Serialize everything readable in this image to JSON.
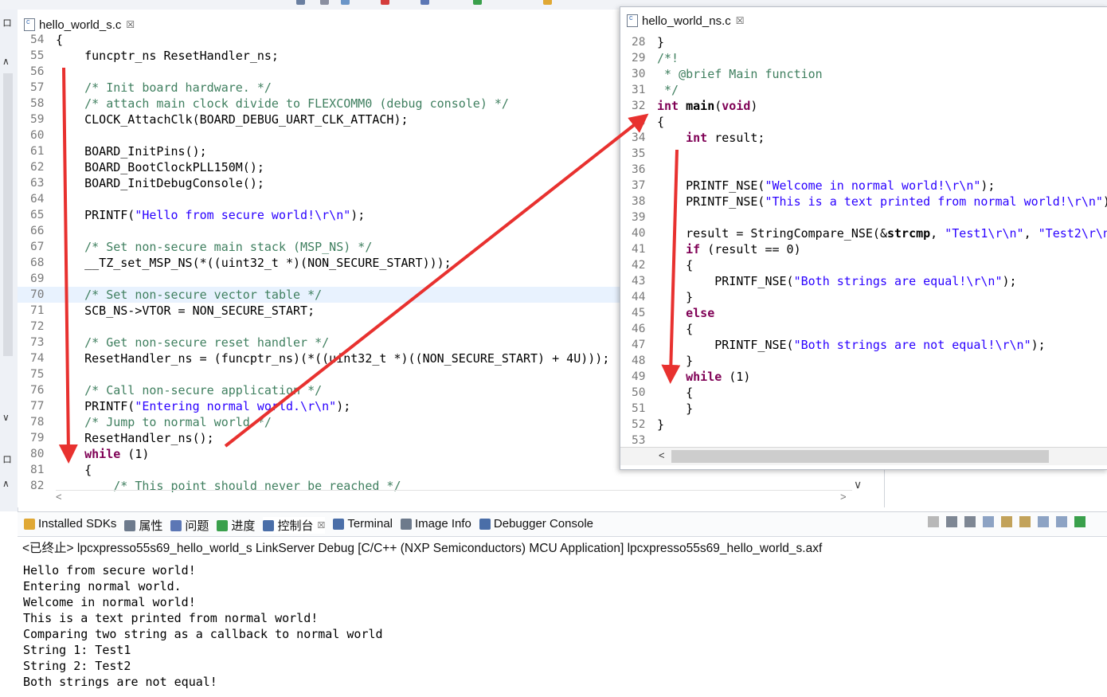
{
  "colors": {
    "arrow": "#e8312f",
    "keyword": "#7f0055",
    "comment": "#3f7f5f",
    "string": "#2a00ff",
    "highlight": "#e8f2fe"
  },
  "main_editor": {
    "tab_title": "hello_world_s.c",
    "lines": [
      {
        "n": "54",
        "text": "{"
      },
      {
        "n": "55",
        "text": "    funcptr_ns ResetHandler_ns;"
      },
      {
        "n": "56",
        "text": ""
      },
      {
        "n": "57",
        "text": "    /* Init board hardware. */"
      },
      {
        "n": "58",
        "text": "    /* attach main clock divide to FLEXCOMM0 (debug console) */"
      },
      {
        "n": "59",
        "text": "    CLOCK_AttachClk(BOARD_DEBUG_UART_CLK_ATTACH);"
      },
      {
        "n": "60",
        "text": ""
      },
      {
        "n": "61",
        "text": "    BOARD_InitPins();"
      },
      {
        "n": "62",
        "text": "    BOARD_BootClockPLL150M();"
      },
      {
        "n": "63",
        "text": "    BOARD_InitDebugConsole();"
      },
      {
        "n": "64",
        "text": ""
      },
      {
        "n": "65",
        "text": "    PRINTF(\"Hello from secure world!\\r\\n\");"
      },
      {
        "n": "66",
        "text": ""
      },
      {
        "n": "67",
        "text": "    /* Set non-secure main stack (MSP_NS) */"
      },
      {
        "n": "68",
        "text": "    __TZ_set_MSP_NS(*((uint32_t *)(NON_SECURE_START)));"
      },
      {
        "n": "69",
        "text": ""
      },
      {
        "n": "70",
        "text": "    /* Set non-secure vector table */"
      },
      {
        "n": "71",
        "text": "    SCB_NS->VTOR = NON_SECURE_START;"
      },
      {
        "n": "72",
        "text": ""
      },
      {
        "n": "73",
        "text": "    /* Get non-secure reset handler */"
      },
      {
        "n": "74",
        "text": "    ResetHandler_ns = (funcptr_ns)(*((uint32_t *)((NON_SECURE_START) + 4U)));"
      },
      {
        "n": "75",
        "text": ""
      },
      {
        "n": "76",
        "text": "    /* Call non-secure application */"
      },
      {
        "n": "77",
        "text": "    PRINTF(\"Entering normal world.\\r\\n\");"
      },
      {
        "n": "78",
        "text": "    /* Jump to normal world */"
      },
      {
        "n": "79",
        "text": "    ResetHandler_ns();"
      },
      {
        "n": "80",
        "text": "    while (1)"
      },
      {
        "n": "81",
        "text": "    {"
      },
      {
        "n": "82",
        "text": "        /* This point should never be reached */"
      }
    ]
  },
  "float_editor": {
    "tab_title": "hello_world_ns.c",
    "lines": [
      {
        "n": "28",
        "text": "}"
      },
      {
        "n": "29",
        "text": "/*!"
      },
      {
        "n": "30",
        "text": " * @brief Main function"
      },
      {
        "n": "31",
        "text": " */"
      },
      {
        "n": "32",
        "text": "int main(void)"
      },
      {
        "n": "33",
        "text": "{"
      },
      {
        "n": "34",
        "text": "    int result;"
      },
      {
        "n": "35",
        "text": ""
      },
      {
        "n": "36",
        "text": ""
      },
      {
        "n": "37",
        "text": "    PRINTF_NSE(\"Welcome in normal world!\\r\\n\");"
      },
      {
        "n": "38",
        "text": "    PRINTF_NSE(\"This is a text printed from normal world!\\r\\n\");"
      },
      {
        "n": "39",
        "text": ""
      },
      {
        "n": "40",
        "text": "    result = StringCompare_NSE(&strcmp, \"Test1\\r\\n\", \"Test2\\r\\n"
      },
      {
        "n": "41",
        "text": "    if (result == 0)"
      },
      {
        "n": "42",
        "text": "    {"
      },
      {
        "n": "43",
        "text": "        PRINTF_NSE(\"Both strings are equal!\\r\\n\");"
      },
      {
        "n": "44",
        "text": "    }"
      },
      {
        "n": "45",
        "text": "    else"
      },
      {
        "n": "46",
        "text": "    {"
      },
      {
        "n": "47",
        "text": "        PRINTF_NSE(\"Both strings are not equal!\\r\\n\");"
      },
      {
        "n": "48",
        "text": "    }"
      },
      {
        "n": "49",
        "text": "    while (1)"
      },
      {
        "n": "50",
        "text": "    {"
      },
      {
        "n": "51",
        "text": "    }"
      },
      {
        "n": "52",
        "text": "}"
      },
      {
        "n": "53",
        "text": ""
      }
    ]
  },
  "console_tabs": [
    {
      "label": "Installed SDKs",
      "icon": "sdk-icon"
    },
    {
      "label": "属性",
      "icon": "properties-icon"
    },
    {
      "label": "问题",
      "icon": "problems-icon"
    },
    {
      "label": "进度",
      "icon": "progress-icon"
    },
    {
      "label": "控制台",
      "icon": "console-icon",
      "active": true
    },
    {
      "label": "Terminal",
      "icon": "terminal-icon"
    },
    {
      "label": "Image Info",
      "icon": "image-info-icon"
    },
    {
      "label": "Debugger Console",
      "icon": "debugger-console-icon"
    }
  ],
  "console": {
    "header": "<已终止> lpcxpresso55s69_hello_world_s LinkServer Debug [C/C++ (NXP Semiconductors) MCU Application] lpcxpresso55s69_hello_world_s.axf",
    "output": [
      "Hello from secure world!",
      "Entering normal world.",
      "Welcome in normal world!",
      "This is a text printed from normal world!",
      "Comparing two string as a callback to normal world",
      "String 1: Test1",
      "String 2: Test2",
      "Both strings are not equal!"
    ]
  },
  "scroll_glyphs": {
    "left": "<",
    "right": ">",
    "down": "∨",
    "up": "∧"
  }
}
